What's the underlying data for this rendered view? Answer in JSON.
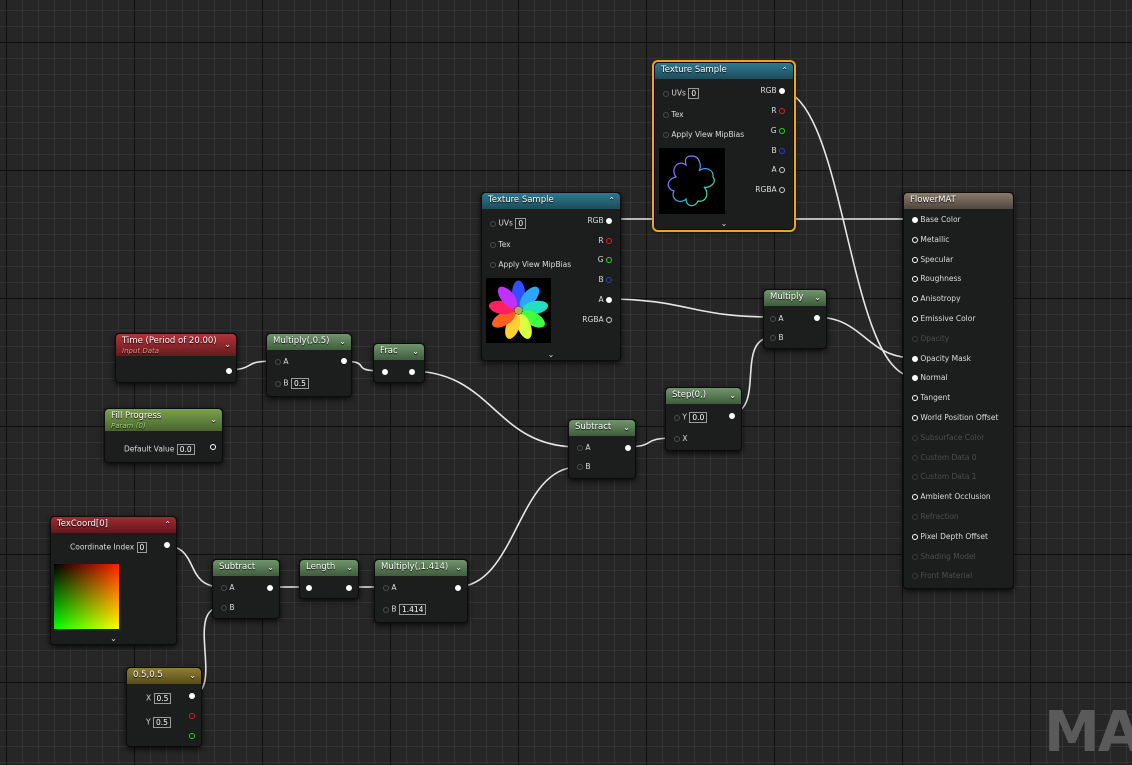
{
  "nodes": {
    "tex_top": {
      "title": "Texture Sample",
      "inputs": {
        "uvs": "UVs",
        "uvs_val": "0",
        "tex": "Tex",
        "mip": "Apply View MipBias"
      },
      "outputs": {
        "rgb": "RGB",
        "r": "R",
        "g": "G",
        "b": "B",
        "a": "A",
        "rgba": "RGBA"
      }
    },
    "tex_mid": {
      "title": "Texture Sample",
      "inputs": {
        "uvs": "UVs",
        "uvs_val": "0",
        "tex": "Tex",
        "mip": "Apply View MipBias"
      },
      "outputs": {
        "rgb": "RGB",
        "r": "R",
        "g": "G",
        "b": "B",
        "a": "A",
        "rgba": "RGBA"
      }
    },
    "time": {
      "title": "Time (Period of 20.00)",
      "subtitle": "Input Data"
    },
    "fill": {
      "title": "Fill Progress",
      "subtitle": "Param (0)",
      "default_label": "Default Value",
      "default_val": "0.0"
    },
    "mult05": {
      "title": "Multiply(,0.5)",
      "a": "A",
      "b": "B",
      "b_val": "0.5"
    },
    "frac": {
      "title": "Frac"
    },
    "subtract1": {
      "title": "Subtract",
      "a": "A",
      "b": "B"
    },
    "step": {
      "title": "Step(0,)",
      "y": "Y",
      "y_val": "0.0",
      "x": "X"
    },
    "multiply": {
      "title": "Multiply",
      "a": "A",
      "b": "B"
    },
    "texcoord": {
      "title": "TexCoord[0]",
      "coord_label": "Coordinate Index",
      "coord_val": "0"
    },
    "subtract2": {
      "title": "Subtract",
      "a": "A",
      "b": "B"
    },
    "length": {
      "title": "Length"
    },
    "mult1414": {
      "title": "Multiply(,1.414)",
      "a": "A",
      "b": "B",
      "b_val": "1.414"
    },
    "const2": {
      "title": "0.5,0.5",
      "x": "X",
      "x_val": "0.5",
      "y": "Y",
      "y_val": "0.5"
    },
    "flowermat": {
      "title": "FlowerMAT",
      "inputs": [
        {
          "label": "Base Color",
          "state": "on"
        },
        {
          "label": "Metallic",
          "state": "white"
        },
        {
          "label": "Specular",
          "state": "white"
        },
        {
          "label": "Roughness",
          "state": "white"
        },
        {
          "label": "Anisotropy",
          "state": "white"
        },
        {
          "label": "Emissive Color",
          "state": "white"
        },
        {
          "label": "Opacity",
          "state": "dim"
        },
        {
          "label": "Opacity Mask",
          "state": "on"
        },
        {
          "label": "Normal",
          "state": "on"
        },
        {
          "label": "Tangent",
          "state": "white"
        },
        {
          "label": "World Position Offset",
          "state": "white"
        },
        {
          "label": "Subsurface Color",
          "state": "dim"
        },
        {
          "label": "Custom Data 0",
          "state": "dim"
        },
        {
          "label": "Custom Data 1",
          "state": "dim"
        },
        {
          "label": "Ambient Occlusion",
          "state": "white"
        },
        {
          "label": "Refraction",
          "state": "dim"
        },
        {
          "label": "Pixel Depth Offset",
          "state": "white"
        },
        {
          "label": "Shading Model",
          "state": "dim"
        },
        {
          "label": "Front Material",
          "state": "dim"
        }
      ]
    }
  },
  "watermark": "MAT",
  "colors": {
    "wire": "#e6e6e6",
    "selection": "#f0a418",
    "background": "#262626"
  }
}
